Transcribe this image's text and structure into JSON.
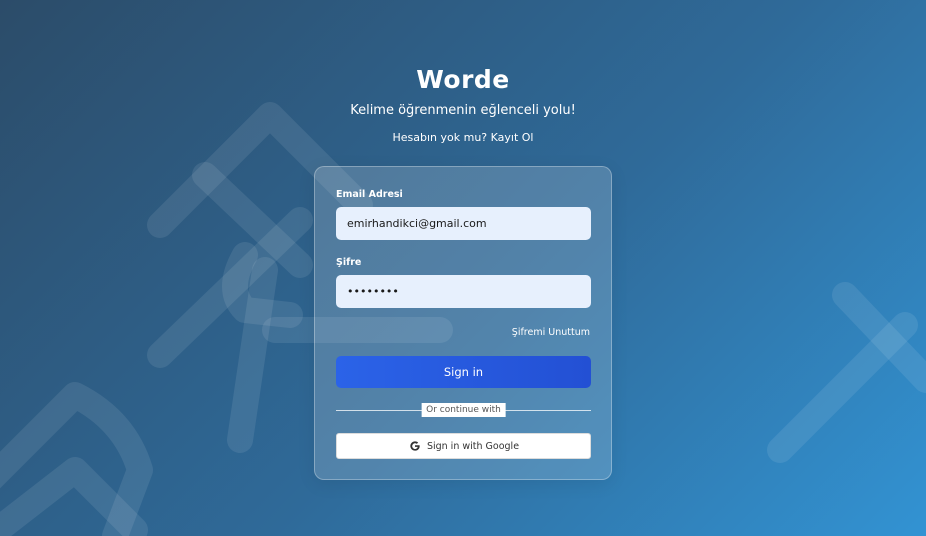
{
  "app": {
    "title": "Worde",
    "subtitle": "Kelime öğrenmenin eğlenceli yolu!",
    "signup_prompt": "Hesabın yok mu?",
    "signup_link": "Kayıt Ol"
  },
  "form": {
    "email_label": "Email Adresi",
    "email_value": "emirhandikci@gmail.com",
    "password_label": "Şifre",
    "password_value": "12345678",
    "forgot_link": "Şifremi Unuttum",
    "signin_button": "Sign in",
    "divider_text": "Or continue with",
    "google_button": "Sign in with Google"
  },
  "icons": {
    "google": "google-g-icon"
  },
  "colors": {
    "bg_start": "#2c4c69",
    "bg_end": "#3293d3",
    "primary_button": "#2b63e8",
    "input_bg": "#e7f0fd"
  }
}
